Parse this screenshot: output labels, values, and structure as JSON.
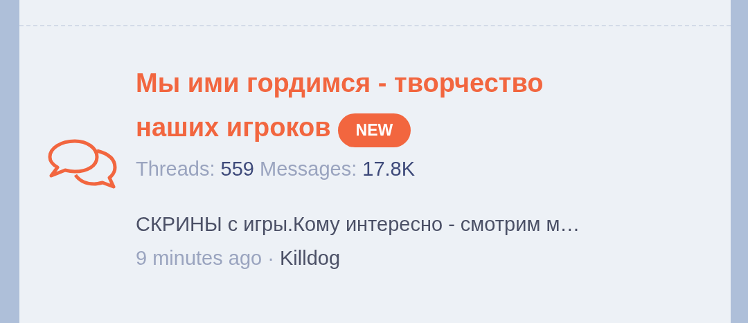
{
  "forum": {
    "title_lines": [
      "Мы ими гордимся - творчество",
      "наших игроков"
    ],
    "badge": "NEW",
    "unread": true,
    "stats": [
      {
        "label": "Threads:",
        "value": "559"
      },
      {
        "label": "Messages:",
        "value": "17.8K"
      }
    ],
    "last_post": {
      "title": "СКРИНЫ с игры.Кому интересно - смотрим м…",
      "time": "9 minutes ago",
      "separator": "·",
      "author": "Killdog"
    }
  }
}
